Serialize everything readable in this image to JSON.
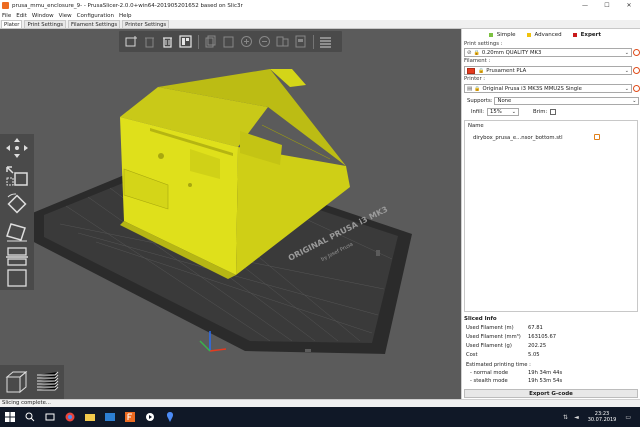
{
  "window": {
    "title": "prusa_mmu_enclosure_9- - PrusaSlicer-2.0.0+win64-201905201652 based on Slic3r",
    "minimize": "—",
    "maximize": "☐",
    "close": "✕"
  },
  "menu": [
    "File",
    "Edit",
    "Window",
    "View",
    "Configuration",
    "Help"
  ],
  "tabs": [
    "Plater",
    "Print Settings",
    "Filament Settings",
    "Printer Settings"
  ],
  "modes": [
    {
      "label": "Simple",
      "color": "#7cc142"
    },
    {
      "label": "Advanced",
      "color": "#f0c20d"
    },
    {
      "label": "Expert",
      "color": "#c8191b"
    }
  ],
  "print_settings": {
    "label": "Print settings :",
    "value": "0.20mm QUALITY MK3"
  },
  "filament": {
    "label": "Filament :",
    "value": "Prusament PLA",
    "swatch": "#e53b1f"
  },
  "printer": {
    "label": "Printer :",
    "value": "Original Prusa i3 MK3S MMU2S Single"
  },
  "supports": {
    "label": "Supports:",
    "value": "None"
  },
  "infill": {
    "label": "Infill:",
    "value": "15%"
  },
  "brim": {
    "label": "Brim:"
  },
  "object_list": {
    "header": "Name",
    "items": [
      "dirybox_prusa_e...nsor_bottom.stl"
    ]
  },
  "sliced_info": {
    "title": "Sliced Info",
    "rows": [
      {
        "label": "Used Filament (m)",
        "value": "67.81"
      },
      {
        "label": "Used Filament (mm³)",
        "value": "163105.67"
      },
      {
        "label": "Used Filament (g)",
        "value": "202.25"
      },
      {
        "label": "Cost",
        "value": "5.05"
      },
      {
        "label": "Estimated printing time :",
        "value": ""
      },
      {
        "label": "- normal mode",
        "value": "19h 34m 44s"
      },
      {
        "label": "- stealth mode",
        "value": "19h 53m 54s"
      }
    ]
  },
  "export_button": "Export G-code",
  "bed_text": {
    "line1": "ORIGINAL PRUSA i3 MK3",
    "line2": "by Josef Prusa"
  },
  "status": "Slicing complete...",
  "taskbar": {
    "time": "23:23",
    "date": "30.07.2019"
  },
  "colors": {
    "model": "#dfe01b",
    "viewport": "#5b5b5b",
    "bed": "#2b2b2b",
    "accent": "#ed6b21"
  }
}
